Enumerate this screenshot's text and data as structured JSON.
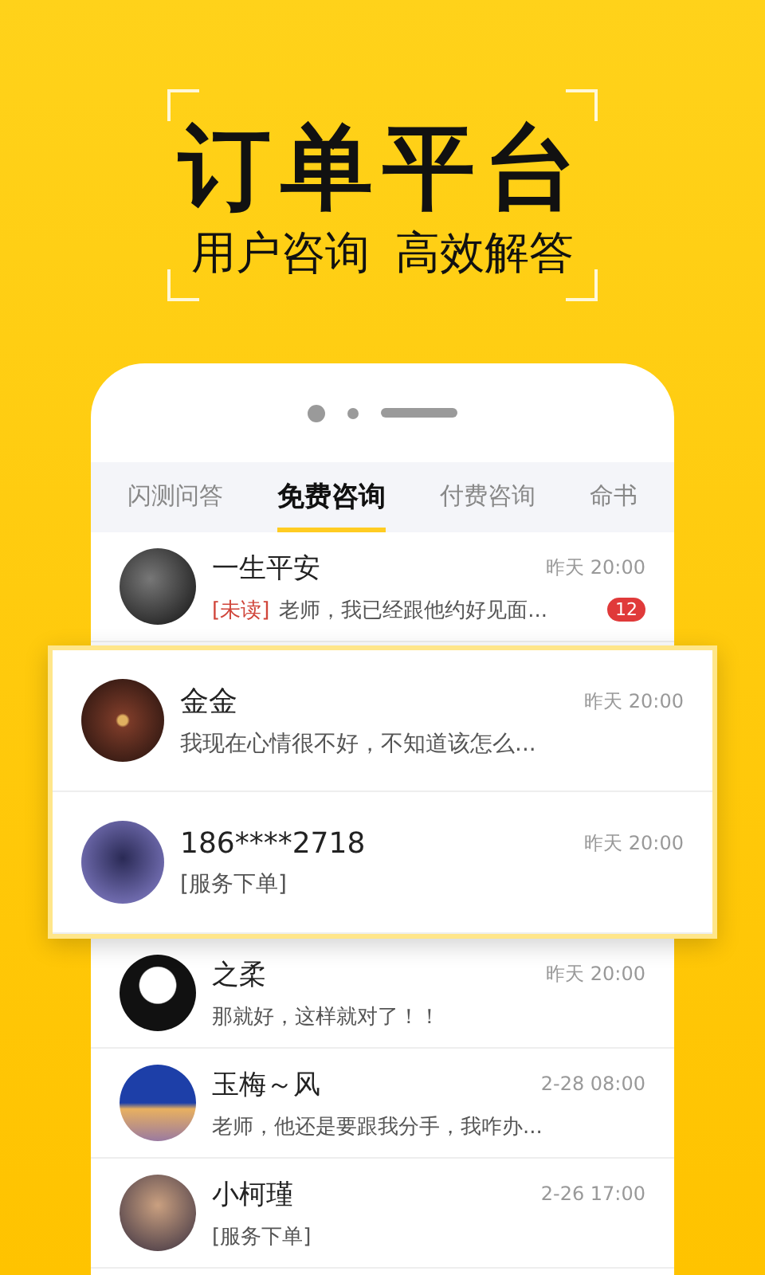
{
  "headline": "订单平台",
  "subtitle": [
    "用户咨询",
    "高效解答"
  ],
  "tabs": [
    {
      "label": "闪测问答",
      "selected": false
    },
    {
      "label": "免费咨询",
      "selected": true
    },
    {
      "label": "付费咨询",
      "selected": false
    },
    {
      "label": "命书",
      "selected": false
    }
  ],
  "conversations": [
    {
      "name": "一生平安",
      "tag": "[未读]",
      "preview": "老师，我已经跟他约好见面...",
      "time": "昨天 20:00",
      "badge": "12",
      "highlighted": false
    },
    {
      "name": "金金",
      "preview": "我现在心情很不好，不知道该怎么...",
      "time": "昨天 20:00",
      "highlighted": true
    },
    {
      "name": "186****2718",
      "preview": "[服务下单]",
      "time": "昨天 20:00",
      "highlighted": true
    },
    {
      "name": "之柔",
      "preview": "那就好，这样就对了！！",
      "time": "昨天 20:00",
      "highlighted": false
    },
    {
      "name": "玉梅～风",
      "preview": "老师，他还是要跟我分手，我咋办...",
      "time": "2-28 08:00",
      "highlighted": false
    },
    {
      "name": "小柯瑾",
      "preview": "[服务下单]",
      "time": "2-26 17:00",
      "highlighted": false
    }
  ]
}
